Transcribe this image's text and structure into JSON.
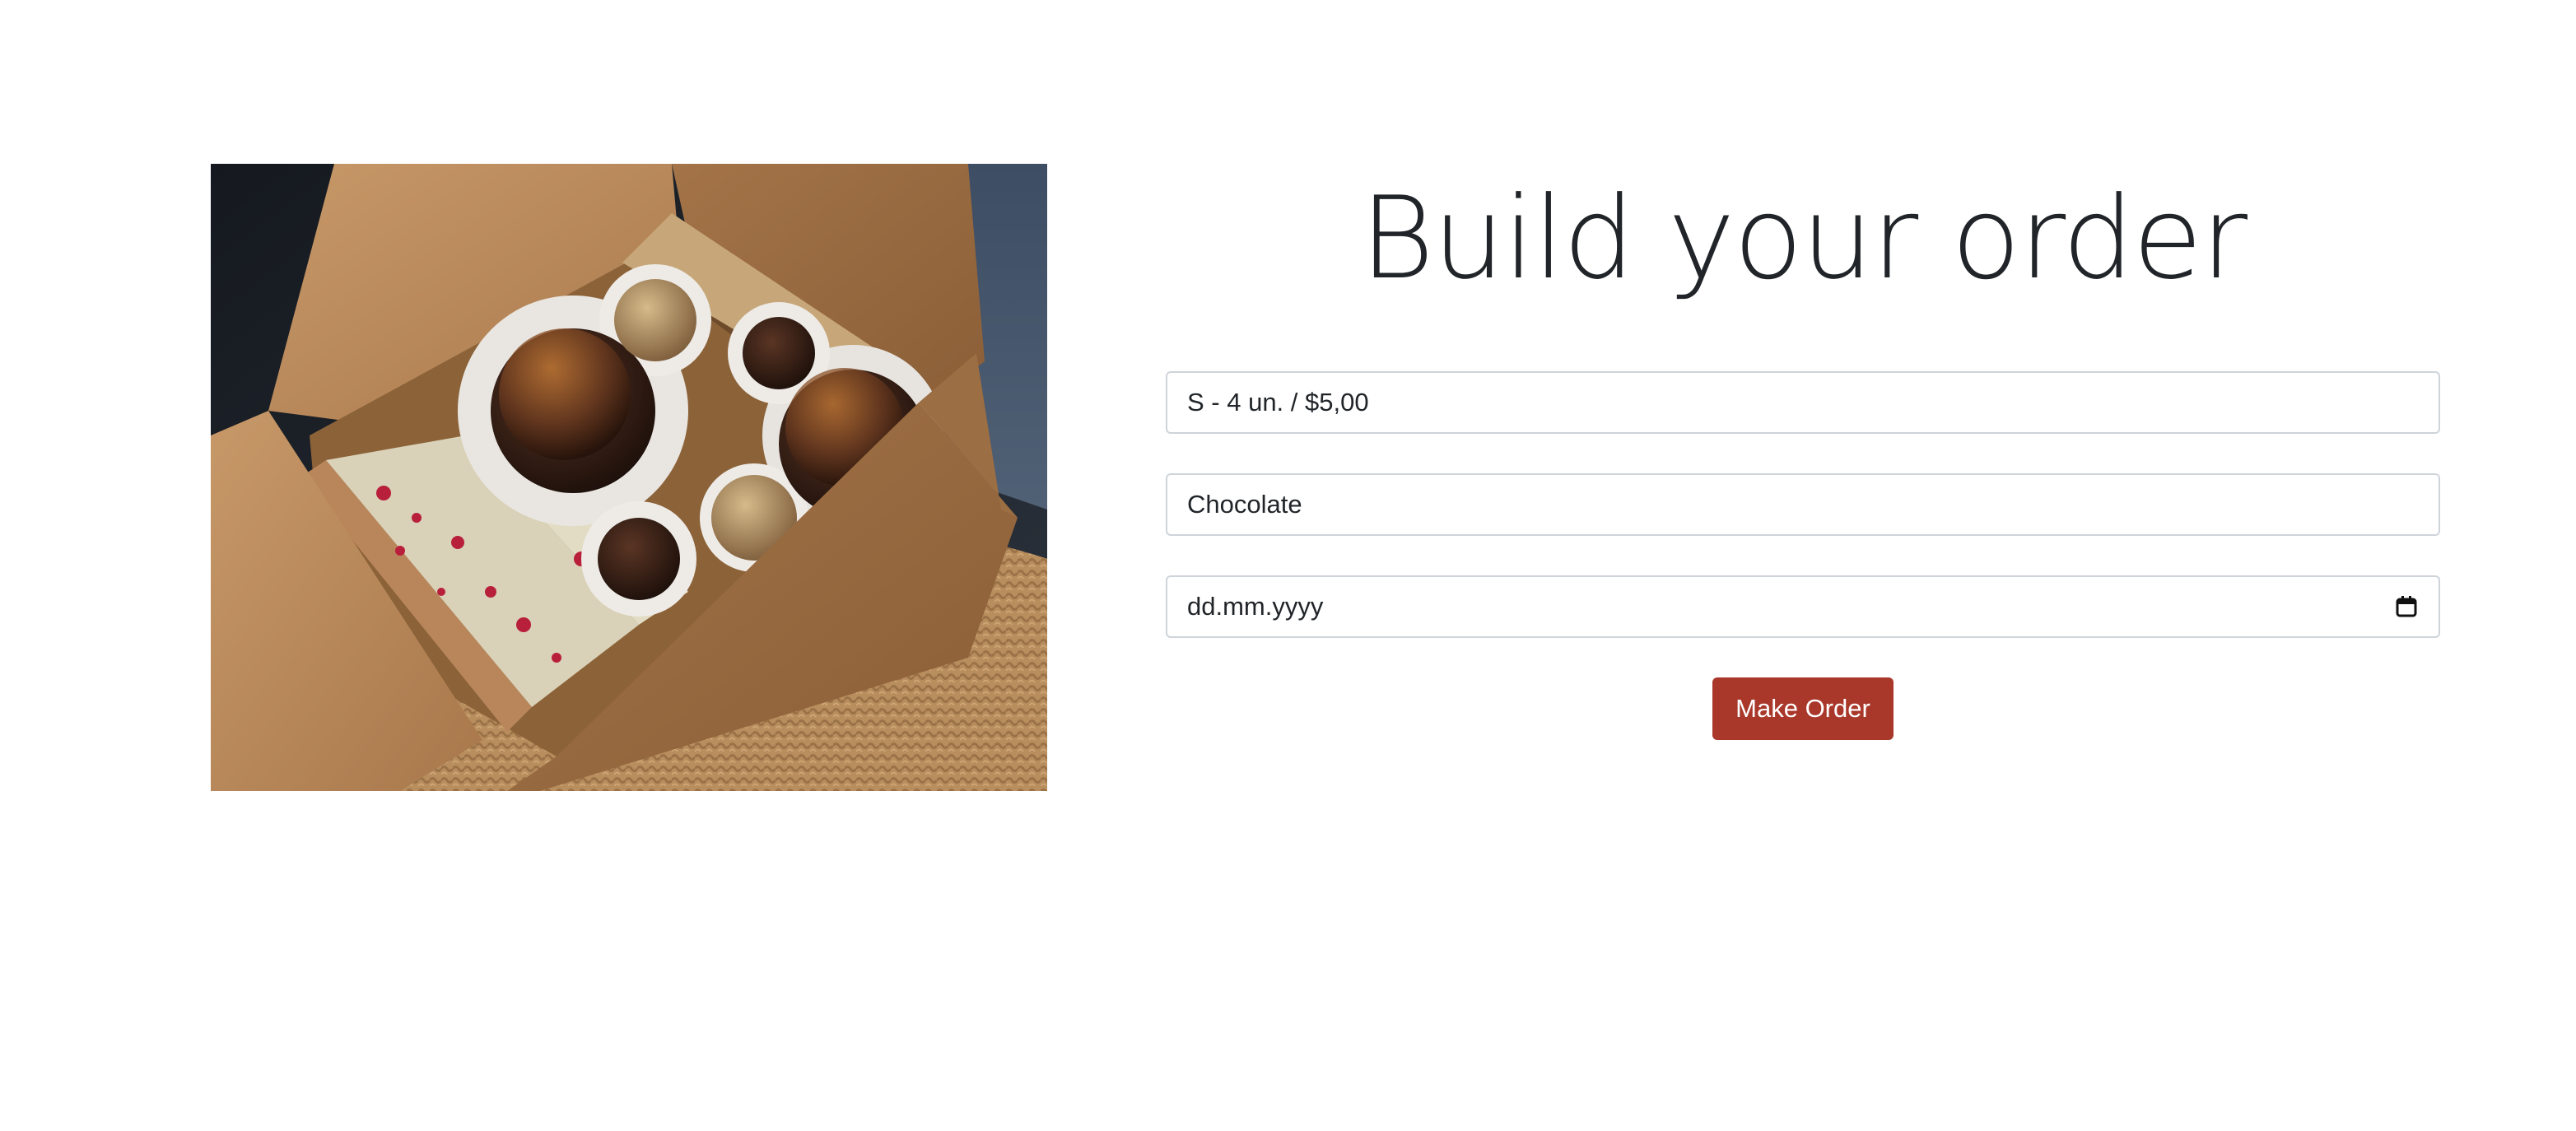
{
  "order": {
    "title": "Build your order",
    "size_field": {
      "value": "S - 4 un. / $5,00"
    },
    "flavor_field": {
      "value": "Chocolate"
    },
    "date_field": {
      "placeholder": "dd.mm.yyyy",
      "icon": "calendar-icon"
    },
    "submit_label": "Make Order"
  },
  "colors": {
    "button": "#a9382b",
    "title": "#212529",
    "field_border": "#ced4da"
  },
  "image": {
    "subject": "chocolate truffles and cake slices in a kraft box"
  }
}
